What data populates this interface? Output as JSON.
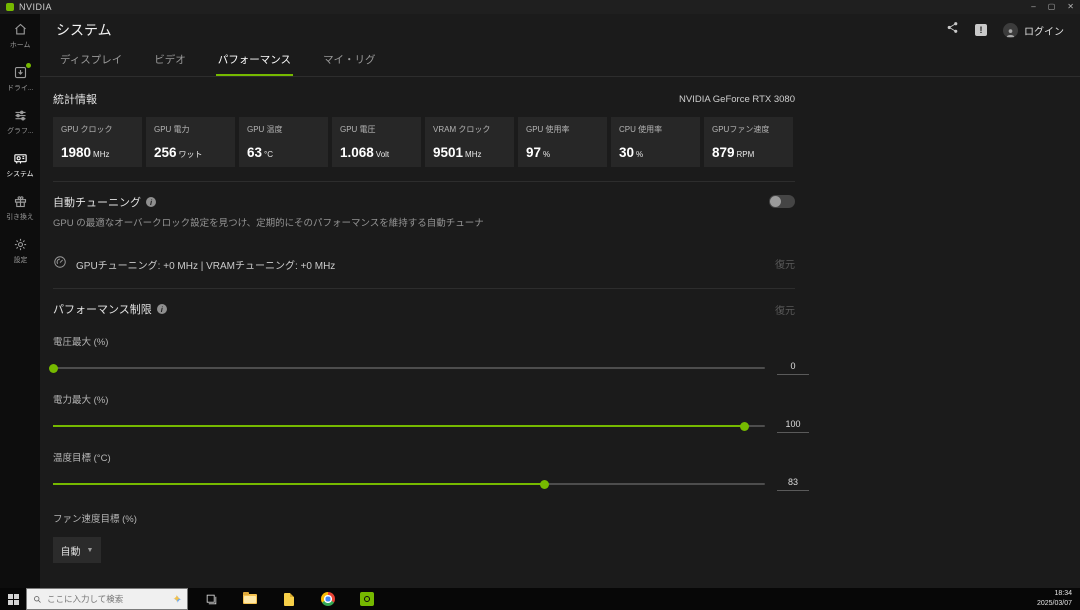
{
  "titlebar": {
    "app_name": "NVIDIA",
    "controls": {
      "minimize": "–",
      "restore": "▢",
      "close": "✕"
    }
  },
  "sidebar": {
    "items": [
      {
        "label": "ホーム",
        "icon": "home-icon",
        "active": false,
        "badge": false
      },
      {
        "label": "ドライ...",
        "icon": "drivers-icon",
        "active": false,
        "badge": true
      },
      {
        "label": "グラフ...",
        "icon": "graphics-icon",
        "active": false,
        "badge": false
      },
      {
        "label": "システム",
        "icon": "system-icon",
        "active": true,
        "badge": false
      },
      {
        "label": "引き換え",
        "icon": "redeem-icon",
        "active": false,
        "badge": false
      },
      {
        "label": "設定",
        "icon": "settings-icon",
        "active": false,
        "badge": false
      }
    ]
  },
  "header": {
    "title": "システム",
    "login_label": "ログイン"
  },
  "tabs": [
    {
      "label": "ディスプレイ",
      "active": false
    },
    {
      "label": "ビデオ",
      "active": false
    },
    {
      "label": "パフォーマンス",
      "active": true
    },
    {
      "label": "マイ・リグ",
      "active": false
    }
  ],
  "stats": {
    "section_title": "統計情報",
    "gpu_name": "NVIDIA GeForce RTX 3080",
    "cards": [
      {
        "label": "GPU クロック",
        "value": "1980",
        "unit": "MHz"
      },
      {
        "label": "GPU 電力",
        "value": "256",
        "unit": "ワット"
      },
      {
        "label": "GPU 温度",
        "value": "63",
        "unit": "°C"
      },
      {
        "label": "GPU 電圧",
        "value": "1.068",
        "unit": "Volt"
      },
      {
        "label": "VRAM クロック",
        "value": "9501",
        "unit": "MHz"
      },
      {
        "label": "GPU 使用率",
        "value": "97",
        "unit": "%"
      },
      {
        "label": "CPU 使用率",
        "value": "30",
        "unit": "%"
      },
      {
        "label": "GPUファン速度",
        "value": "879",
        "unit": "RPM"
      }
    ]
  },
  "auto_tuning": {
    "title": "自動チューニング",
    "description": "GPU の最適なオーバークロック設定を見つけ、定期的にそのパフォーマンスを維持する自動チューナ",
    "enabled": false,
    "status_text": "GPUチューニング: +0 MHz | VRAMチューニング: +0 MHz",
    "restore_label": "復元"
  },
  "performance_limits": {
    "title": "パフォーマンス制限",
    "restore_label": "復元",
    "sliders": [
      {
        "label": "電圧最大 (%)",
        "value": "0",
        "percent": 0
      },
      {
        "label": "電力最大 (%)",
        "value": "100",
        "percent": 97
      },
      {
        "label": "温度目標 (°C)",
        "value": "83",
        "percent": 69
      }
    ],
    "fan_target_label": "ファン速度目標 (%)",
    "fan_target_value": "自動"
  },
  "taskbar": {
    "search_placeholder": "ここに入力して検索",
    "clock": {
      "time": "18:34",
      "date": "2025/03/07"
    }
  },
  "colors": {
    "accent": "#76b900"
  }
}
